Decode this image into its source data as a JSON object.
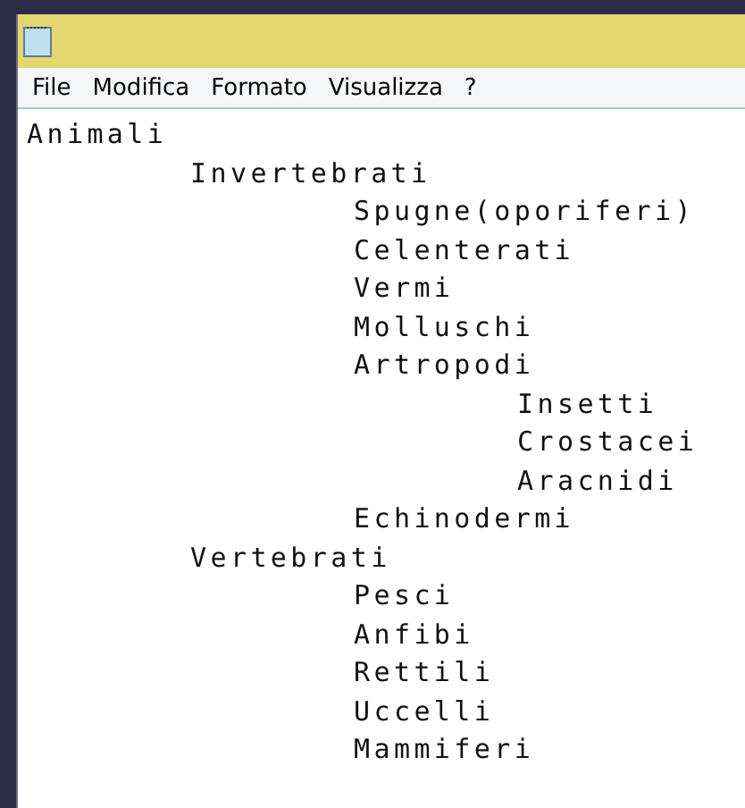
{
  "menu": [
    "File",
    "Modifica",
    "Formato",
    "Visualizza",
    "?"
  ],
  "outline": [
    {
      "text": "Animali",
      "children": [
        {
          "text": "Invertebrati",
          "children": [
            {
              "text": "Spugne(oporiferi)"
            },
            {
              "text": "Celenterati"
            },
            {
              "text": "Vermi"
            },
            {
              "text": "Molluschi"
            },
            {
              "text": "Artropodi",
              "children": [
                {
                  "text": "Insetti"
                },
                {
                  "text": "Crostacei"
                },
                {
                  "text": "Aracnidi"
                }
              ]
            },
            {
              "text": "Echinodermi"
            }
          ]
        },
        {
          "text": "Vertebrati",
          "children": [
            {
              "text": "Pesci"
            },
            {
              "text": "Anfibi"
            },
            {
              "text": "Rettili"
            },
            {
              "text": "Uccelli"
            },
            {
              "text": "Mammiferi"
            }
          ]
        }
      ]
    }
  ]
}
